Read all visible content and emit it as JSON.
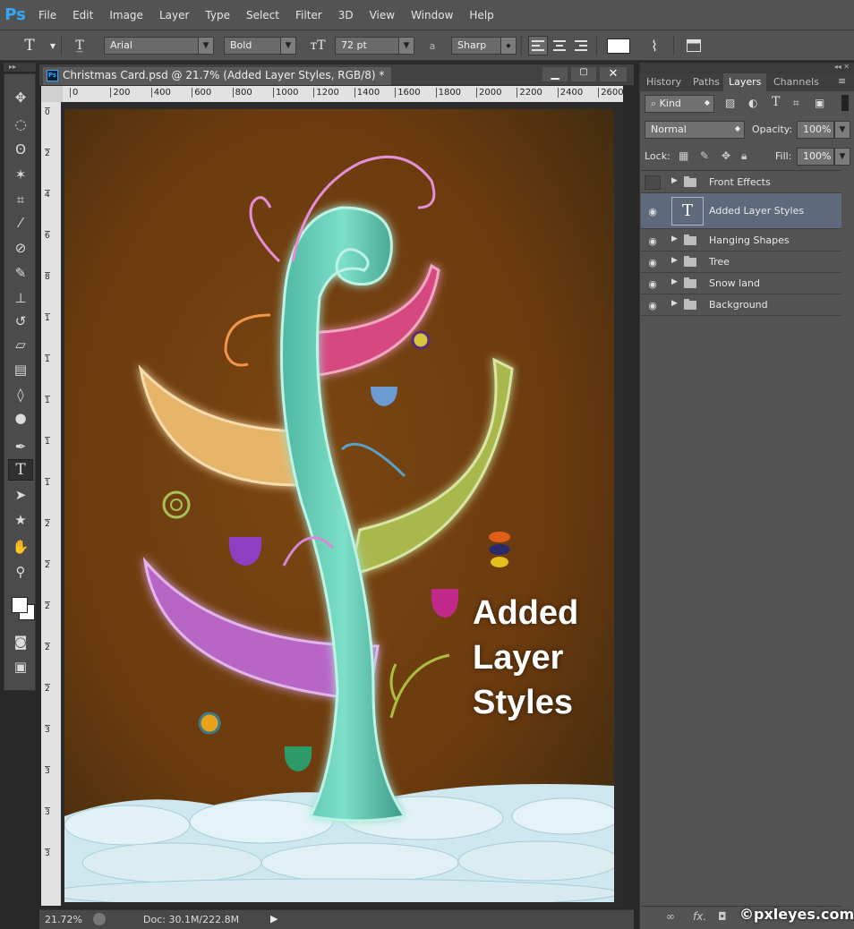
{
  "app": {
    "logo": "Ps"
  },
  "menu": [
    "File",
    "Edit",
    "Image",
    "Layer",
    "Type",
    "Select",
    "Filter",
    "3D",
    "View",
    "Window",
    "Help"
  ],
  "options": {
    "tool_icon": "T",
    "font_family": "Arial",
    "font_style": "Bold",
    "font_size": "72 pt",
    "aa_label": "a",
    "aa_mode": "Sharp"
  },
  "document": {
    "tab_title": "Christmas Card.psd @ 21.7% (Added Layer Styles, RGB/8) *",
    "ruler_top": [
      "0",
      "200",
      "400",
      "600",
      "800",
      "1000",
      "1200",
      "1400",
      "1600",
      "1800",
      "2000",
      "2200",
      "2400",
      "2600"
    ],
    "ruler_left": [
      "0",
      "2",
      "4",
      "6",
      "8",
      "1",
      "1",
      "1",
      "1",
      "1",
      "2",
      "2",
      "2",
      "2",
      "2",
      "3",
      "3",
      "3",
      "3"
    ],
    "canvas_text": [
      "Added",
      "Layer",
      "Styles"
    ]
  },
  "status": {
    "zoom": "21.72%",
    "doc_size": "Doc: 30.1M/222.8M"
  },
  "panel": {
    "tabs": [
      "History",
      "Paths",
      "Layers",
      "Channels"
    ],
    "active_tab": "Layers",
    "kind_label": "Kind",
    "blend_mode": "Normal",
    "opacity_label": "Opacity:",
    "opacity_value": "100%",
    "lock_label": "Lock:",
    "fill_label": "Fill:",
    "fill_value": "100%",
    "layers": [
      {
        "name": "Front Effects",
        "type": "group",
        "visible": false
      },
      {
        "name": "Added Layer Styles",
        "type": "text",
        "visible": true,
        "selected": true
      },
      {
        "name": "Hanging Shapes",
        "type": "group",
        "visible": true
      },
      {
        "name": "Tree",
        "type": "group",
        "visible": true
      },
      {
        "name": "Snow land",
        "type": "group",
        "visible": true
      },
      {
        "name": "Background",
        "type": "group",
        "visible": true
      }
    ]
  },
  "watermark": "©pxleyes.com",
  "colors": {
    "ui_dark": "#282828",
    "ui_mid": "#535353",
    "selected_layer": "#5e6a7c",
    "ps_blue": "#31a8ff"
  }
}
